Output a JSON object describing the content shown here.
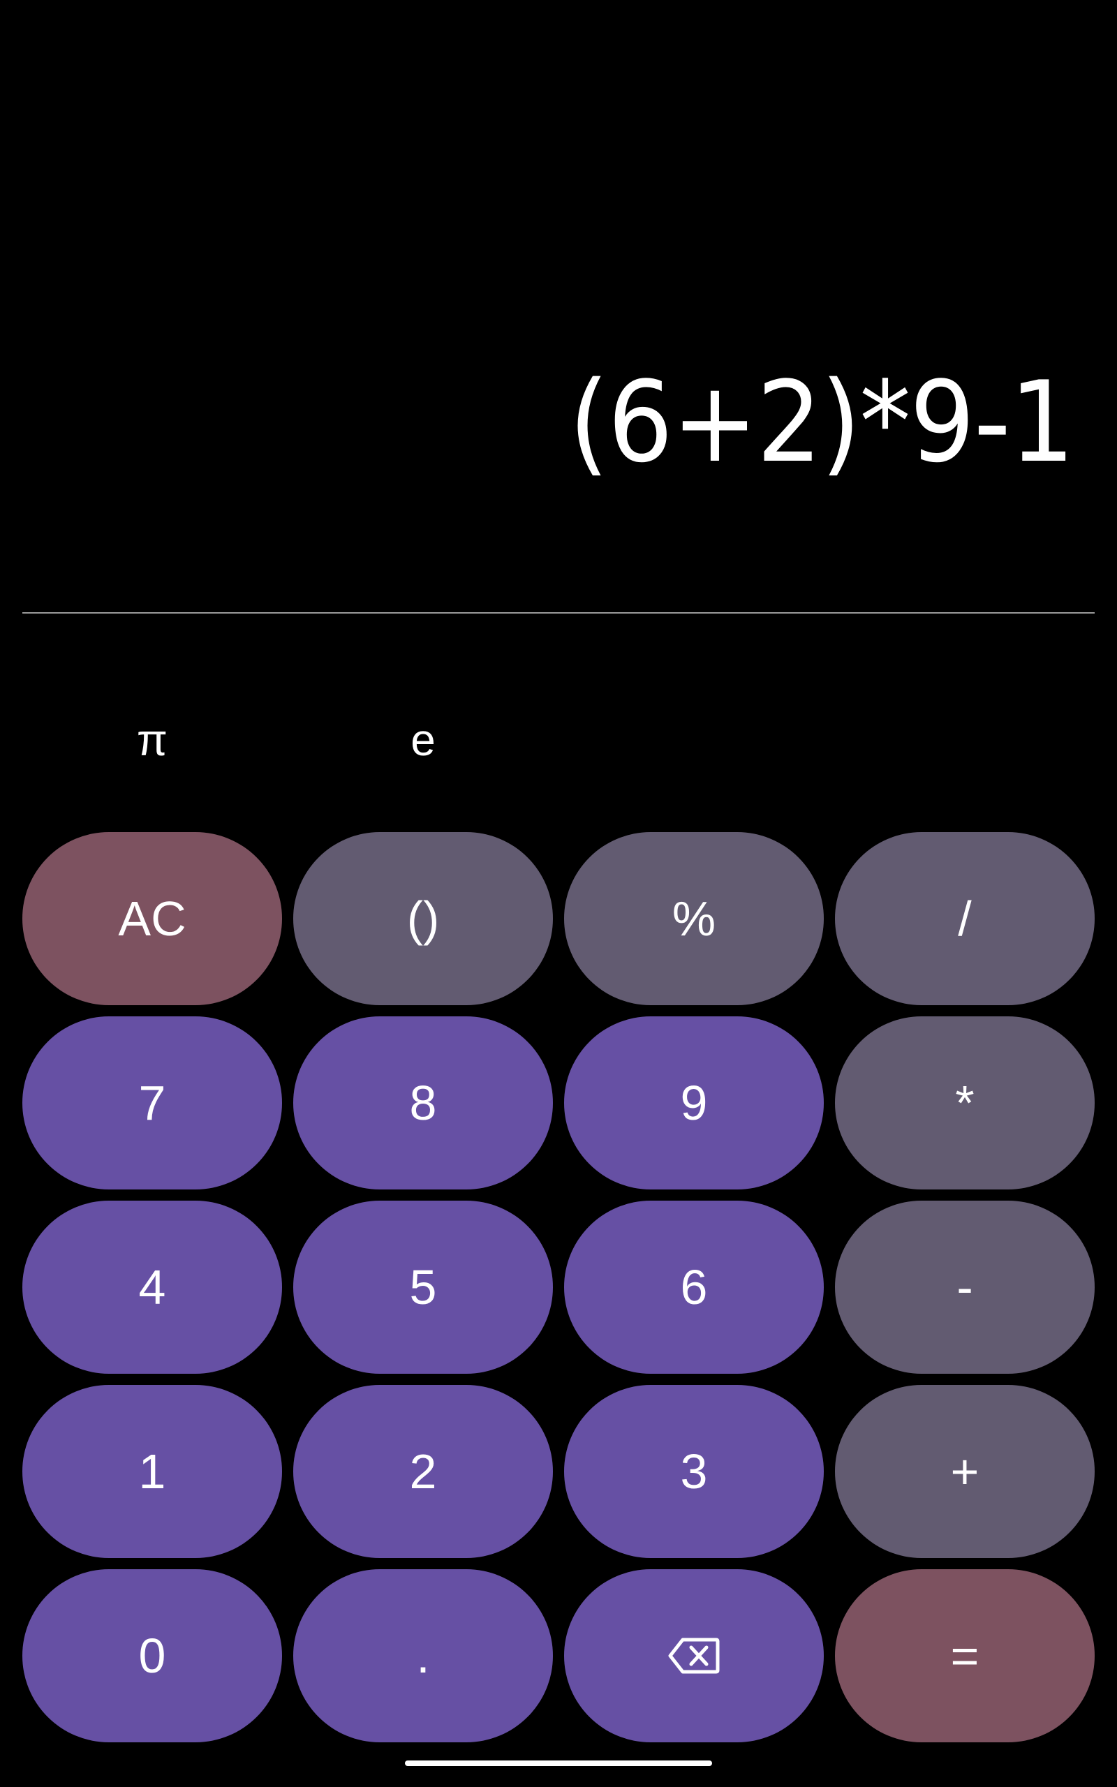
{
  "display": {
    "expression": "(6+2)*9-1"
  },
  "constants": [
    {
      "label": "π",
      "name": "pi-key"
    },
    {
      "label": "e",
      "name": "e-key"
    }
  ],
  "keys": {
    "ac": "AC",
    "parens": "()",
    "percent": "%",
    "divide": "/",
    "seven": "7",
    "eight": "8",
    "nine": "9",
    "multiply": "*",
    "four": "4",
    "five": "5",
    "six": "6",
    "minus": "-",
    "one": "1",
    "two": "2",
    "three": "3",
    "plus": "+",
    "zero": "0",
    "decimal": ".",
    "backspace_icon": "backspace-icon",
    "equals": "="
  },
  "colors": {
    "background": "#000000",
    "number_key": "#6650a4",
    "operator_key": "#625b71",
    "accent_key": "#7d5260",
    "text": "#ffffff"
  }
}
